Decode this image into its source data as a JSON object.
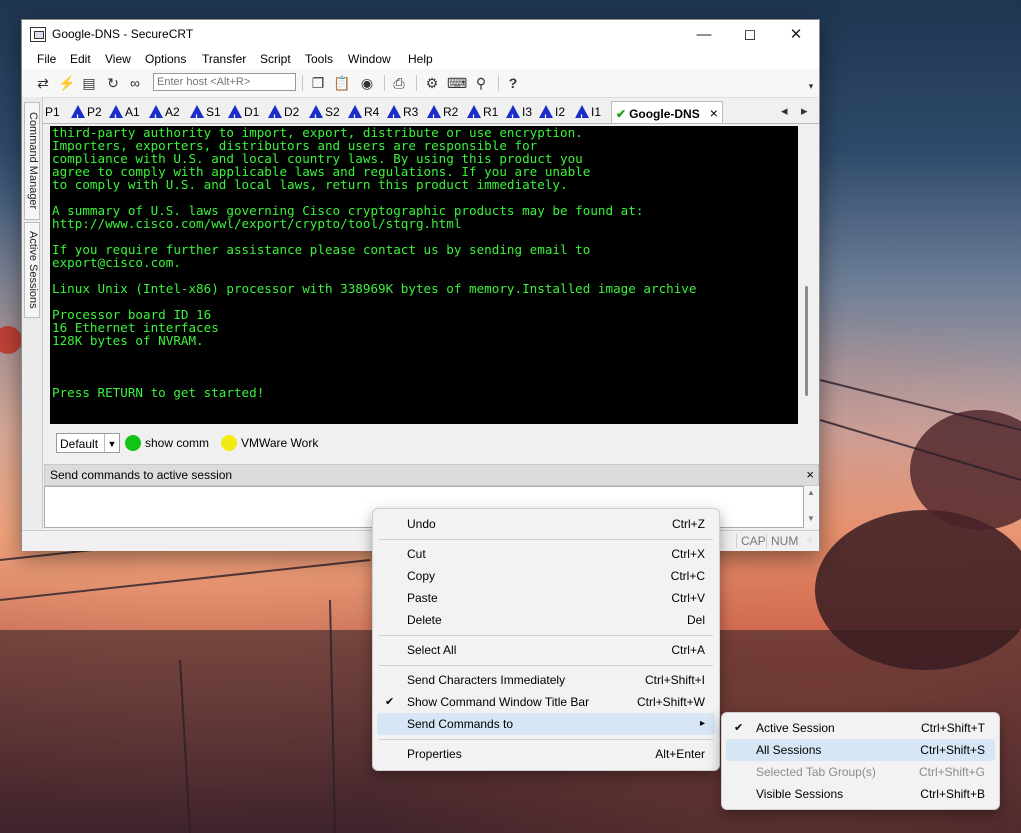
{
  "window": {
    "title": "Google-DNS - SecureCRT"
  },
  "menubar": [
    "File",
    "Edit",
    "View",
    "Options",
    "Transfer",
    "Script",
    "Tools",
    "Window",
    "Help"
  ],
  "toolbar": {
    "host_placeholder": "Enter host <Alt+R>",
    "help_label": "?"
  },
  "sidebar": {
    "command_manager": "Command Manager",
    "active_sessions": "Active Sessions"
  },
  "tabs": [
    {
      "label": "P1",
      "warning": false
    },
    {
      "label": "P2",
      "warning": true
    },
    {
      "label": "A1",
      "warning": true
    },
    {
      "label": "A2",
      "warning": true
    },
    {
      "label": "S1",
      "warning": true
    },
    {
      "label": "D1",
      "warning": true
    },
    {
      "label": "D2",
      "warning": true
    },
    {
      "label": "S2",
      "warning": true
    },
    {
      "label": "R4",
      "warning": true
    },
    {
      "label": "R3",
      "warning": true
    },
    {
      "label": "R2",
      "warning": true
    },
    {
      "label": "R1",
      "warning": true
    },
    {
      "label": "I3",
      "warning": true
    },
    {
      "label": "I2",
      "warning": true
    },
    {
      "label": "I1",
      "warning": true
    },
    {
      "label": "Google-DNS",
      "warning": false,
      "active": true
    }
  ],
  "terminal": {
    "lines": [
      "third-party authority to import, export, distribute or use encryption.",
      "Importers, exporters, distributors and users are responsible for",
      "compliance with U.S. and local country laws. By using this product you",
      "agree to comply with applicable laws and regulations. If you are unable",
      "to comply with U.S. and local laws, return this product immediately.",
      "",
      "A summary of U.S. laws governing Cisco cryptographic products may be found at:",
      "http://www.cisco.com/wwl/export/crypto/tool/stqrg.html",
      "",
      "If you require further assistance please contact us by sending email to",
      "export@cisco.com.",
      "",
      "Linux Unix (Intel-x86) processor with 338969K bytes of memory.Installed image archive",
      "",
      "Processor board ID 16",
      "16 Ethernet interfaces",
      "128K bytes of NVRAM.",
      "",
      "",
      "",
      "Press RETURN to get started!"
    ],
    "text_color": "#3bf23b"
  },
  "buttonbar": {
    "group": "Default",
    "buttons": [
      {
        "label": "show comm",
        "color": "#14c414"
      },
      {
        "label": "VMWare Work",
        "color": "#f2ea10"
      }
    ]
  },
  "command_window": {
    "title": "Send commands to active session",
    "close": "×"
  },
  "statusbar": {
    "cap": "CAP",
    "num": "NUM"
  },
  "context_menu": {
    "items": [
      {
        "label": "Undo",
        "shortcut": "Ctrl+Z"
      },
      {
        "label": "Cut",
        "shortcut": "Ctrl+X"
      },
      {
        "label": "Copy",
        "shortcut": "Ctrl+C"
      },
      {
        "label": "Paste",
        "shortcut": "Ctrl+V"
      },
      {
        "label": "Delete",
        "shortcut": "Del"
      },
      {
        "label": "Select All",
        "shortcut": "Ctrl+A"
      },
      {
        "label": "Send Characters Immediately",
        "shortcut": "Ctrl+Shift+I"
      },
      {
        "label": "Show Command Window Title Bar",
        "shortcut": "Ctrl+Shift+W",
        "checked": true
      },
      {
        "label": "Send Commands to",
        "shortcut": "",
        "submenu": true,
        "highlighted": true
      },
      {
        "label": "Properties",
        "shortcut": "Alt+Enter"
      }
    ]
  },
  "submenu": {
    "items": [
      {
        "label": "Active Session",
        "shortcut": "Ctrl+Shift+T",
        "checked": true
      },
      {
        "label": "All Sessions",
        "shortcut": "Ctrl+Shift+S",
        "highlighted": true
      },
      {
        "label": "Selected Tab Group(s)",
        "shortcut": "Ctrl+Shift+G",
        "disabled": true
      },
      {
        "label": "Visible Sessions",
        "shortcut": "Ctrl+Shift+B"
      }
    ]
  }
}
